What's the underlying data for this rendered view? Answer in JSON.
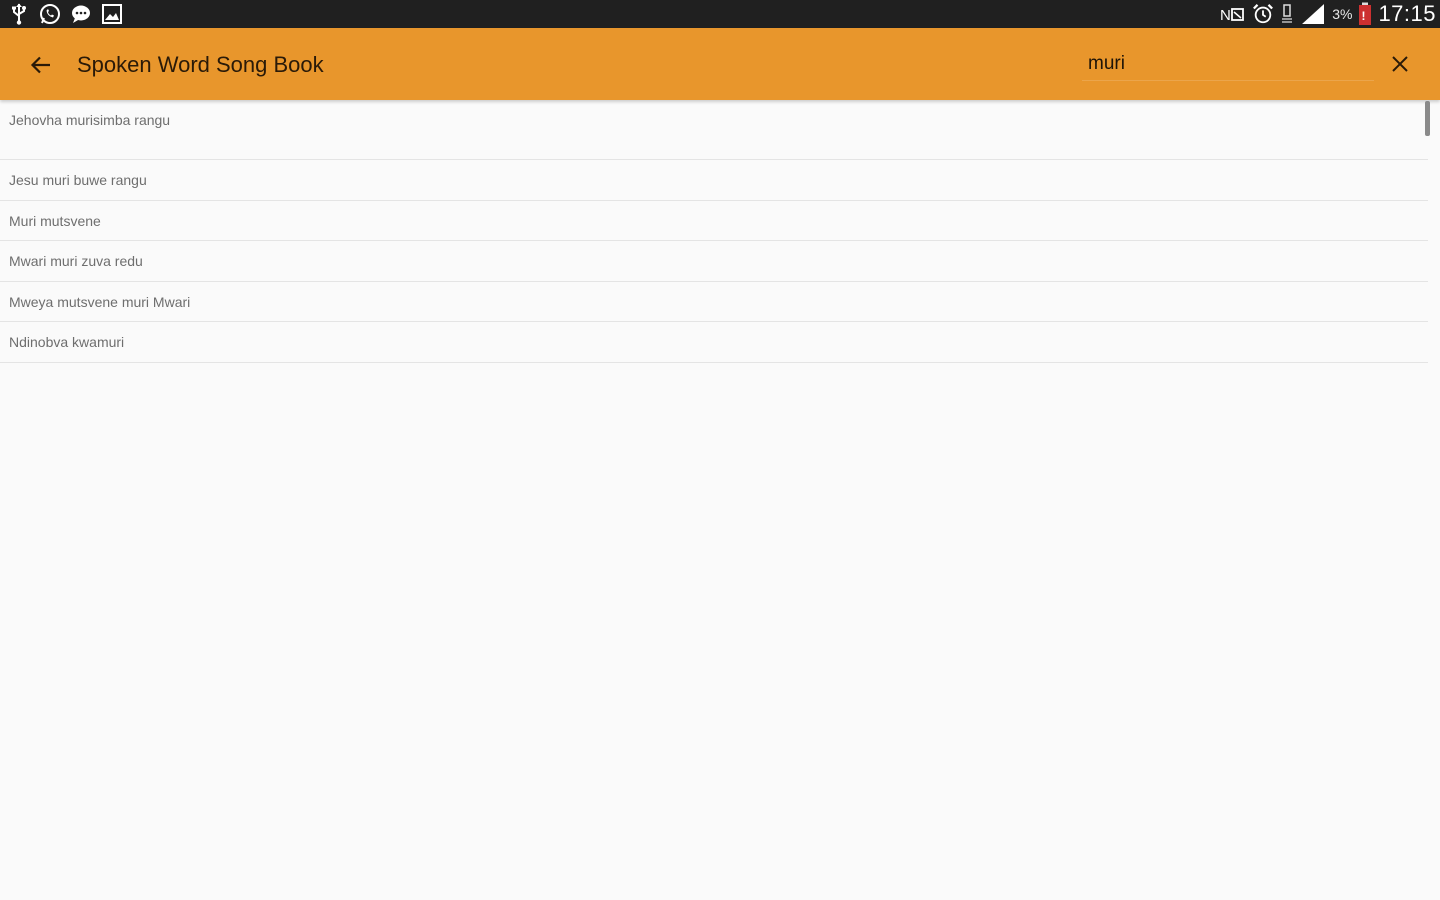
{
  "status_bar": {
    "left_icons": [
      "usb-icon",
      "whatsapp-icon",
      "chat-icon",
      "image-icon"
    ],
    "right_icons": [
      "nfc-icon",
      "alarm-icon",
      "vibrate-icon",
      "signal-icon",
      "battery-icon"
    ],
    "battery_percent": "3%",
    "time": "17:15"
  },
  "toolbar": {
    "back_icon": "arrow-left-icon",
    "title": "Spoken Word Song Book",
    "search_value": "muri",
    "clear_icon": "close-icon",
    "color": "#e8962c"
  },
  "results": [
    {
      "title": "Jehovha murisimba rangu"
    },
    {
      "title": "Jesu muri buwe rangu"
    },
    {
      "title": "Muri mutsvene"
    },
    {
      "title": "Mwari muri zuva redu"
    },
    {
      "title": "Mweya mutsvene muri Mwari"
    },
    {
      "title": "Ndinobva kwamuri"
    }
  ]
}
